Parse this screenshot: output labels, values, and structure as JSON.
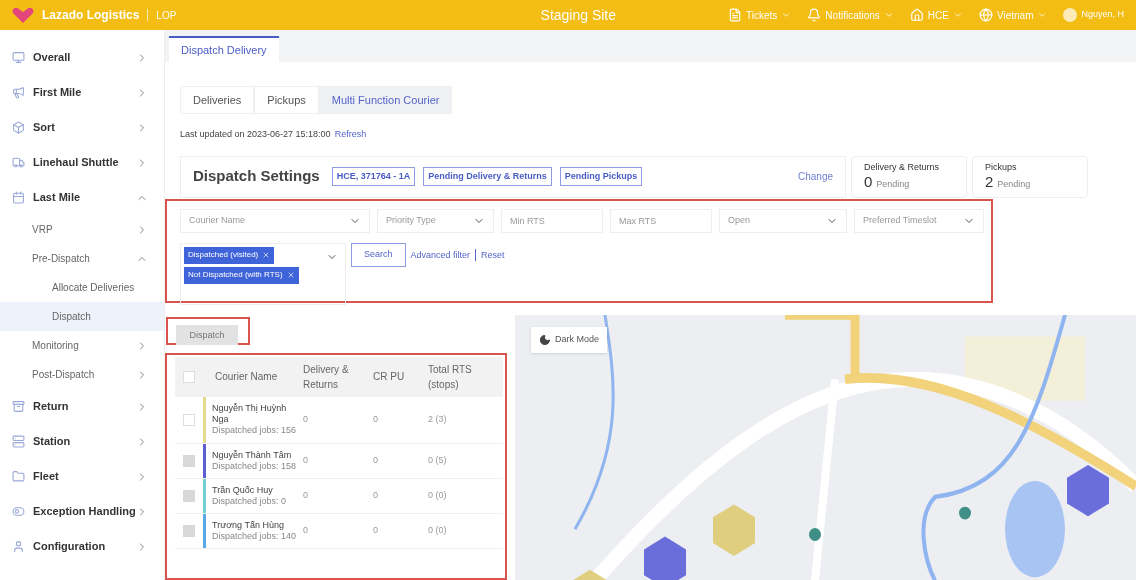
{
  "header": {
    "brand": "Lazado Logistics",
    "product": "LOP",
    "site_title": "Staging Site",
    "menu": [
      {
        "label": "Tickets"
      },
      {
        "label": "Notifications"
      },
      {
        "label": "HCE"
      },
      {
        "label": "Vietnam"
      }
    ],
    "user": "Nguyen, H"
  },
  "sidebar": {
    "items": [
      {
        "label": "Overall",
        "expanded": false,
        "selected": false
      },
      {
        "label": "First Mile",
        "expanded": false,
        "selected": false
      },
      {
        "label": "Sort",
        "expanded": false,
        "selected": false
      },
      {
        "label": "Linehaul Shuttle",
        "expanded": false,
        "selected": false
      },
      {
        "label": "Last Mile",
        "expanded": true,
        "selected": false,
        "children": [
          {
            "label": "VRP",
            "expanded": false,
            "selected": false
          },
          {
            "label": "Pre-Dispatch",
            "expanded": true,
            "selected": false,
            "children": [
              {
                "label": "Allocate Deliveries",
                "selected": false
              },
              {
                "label": "Dispatch",
                "selected": true
              }
            ]
          },
          {
            "label": "Monitoring",
            "expanded": false,
            "selected": false
          },
          {
            "label": "Post-Dispatch",
            "expanded": false,
            "selected": false
          }
        ]
      },
      {
        "label": "Return",
        "expanded": false,
        "selected": false
      },
      {
        "label": "Station",
        "expanded": false,
        "selected": false
      },
      {
        "label": "Fleet",
        "expanded": false,
        "selected": false
      },
      {
        "label": "Exception Handling",
        "expanded": false,
        "selected": false
      },
      {
        "label": "Configuration",
        "expanded": false,
        "selected": false
      }
    ]
  },
  "page_tabs": [
    {
      "label": "Dispatch Delivery",
      "selected": true
    }
  ],
  "sub_tabs": [
    {
      "label": "Deliveries",
      "selected": false
    },
    {
      "label": "Pickups",
      "selected": false
    },
    {
      "label": "Multi Function Courier",
      "selected": true
    }
  ],
  "last_updated": {
    "text": "Last updated on 2023-06-27 15:18:00",
    "link": "Refresh"
  },
  "dispatch_settings": {
    "title": "Dispatch Settings",
    "tags": [
      "HCE, 371764 - 1A",
      "Pending Delivery & Returns",
      "Pending Pickups"
    ],
    "change": "Change"
  },
  "summary": [
    {
      "title": "Delivery & Returns",
      "count": "0",
      "status": "Pending"
    },
    {
      "title": "Pickups",
      "count": "2",
      "status": "Pending"
    }
  ],
  "filters": {
    "fields": [
      {
        "kind": "select",
        "placeholder": "Courier Name"
      },
      {
        "kind": "select",
        "placeholder": "Priority Type"
      },
      {
        "kind": "input",
        "placeholder": "Min RTS"
      },
      {
        "kind": "input",
        "placeholder": "Max RTS"
      },
      {
        "kind": "select",
        "placeholder": "Open"
      },
      {
        "kind": "select",
        "placeholder": "Preferred Timeslot"
      }
    ],
    "status_chips": [
      "Dispatched (visited)",
      "Not Dispatched (with RTS)"
    ],
    "search": "Search",
    "advanced_filter": "Advanced filter",
    "reset": "Reset"
  },
  "dispatch_button": {
    "label": "Dispatch",
    "disabled": true
  },
  "table": {
    "select_all": {
      "checked": false
    },
    "columns": [
      "Courier Name",
      "Delivery & Returns",
      "CR PU",
      "Total RTS (stops)"
    ],
    "rows": [
      {
        "name": "Nguyễn Thị Huỳnh Nga",
        "jobs": "Dispatched jobs: 156",
        "delivery_returns": "0",
        "cr_pu": "0",
        "total_rts": "2 (3)",
        "color": "#e2dc8e",
        "checked": false,
        "disabled": false
      },
      {
        "name": "Nguyễn Thành Tâm",
        "jobs": "Dispatched jobs: 158",
        "delivery_returns": "0",
        "cr_pu": "0",
        "total_rts": "0 (5)",
        "color": "#5b5fd0",
        "checked": false,
        "disabled": true
      },
      {
        "name": "Trần Quốc Huy",
        "jobs": "Dispatched jobs: 0",
        "delivery_returns": "0",
        "cr_pu": "0",
        "total_rts": "0 (0)",
        "color": "#72d0d0",
        "checked": false,
        "disabled": true
      },
      {
        "name": "Trương Tấn Hùng",
        "jobs": "Dispatched jobs: 140",
        "delivery_returns": "0",
        "cr_pu": "0",
        "total_rts": "0 (0)",
        "color": "#5aa6e6",
        "checked": false,
        "disabled": true
      }
    ]
  },
  "map": {
    "kind": "picture",
    "dark_mode": "Dark Mode"
  }
}
